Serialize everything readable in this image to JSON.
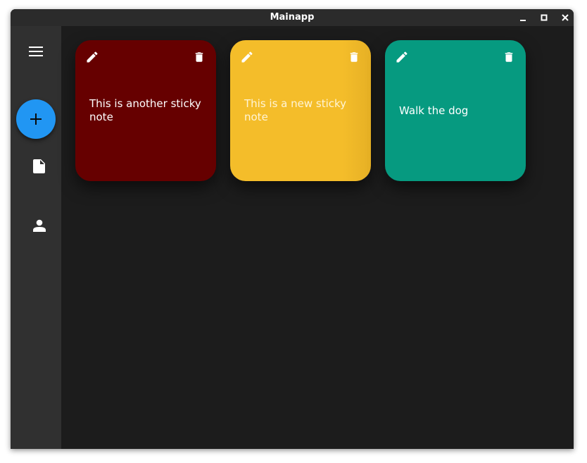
{
  "window": {
    "title": "Mainapp"
  },
  "window_controls": [
    {
      "name": "minimize",
      "icon": "minimize-icon"
    },
    {
      "name": "maximize",
      "icon": "maximize-icon"
    },
    {
      "name": "close",
      "icon": "close-icon"
    }
  ],
  "rail": {
    "items": [
      {
        "name": "menu",
        "icon": "menu-icon"
      },
      {
        "name": "add",
        "icon": "plus-icon",
        "color": "#2196f3"
      },
      {
        "name": "notes",
        "icon": "document-icon"
      },
      {
        "name": "account",
        "icon": "person-icon"
      }
    ]
  },
  "notes": [
    {
      "text": "This is another sticky note",
      "color": "#660000",
      "edit_icon": "pencil-icon",
      "delete_icon": "trash-icon"
    },
    {
      "text": "This is a new sticky note",
      "color": "#f4bd2a",
      "edit_icon": "pencil-icon",
      "delete_icon": "trash-icon"
    },
    {
      "text": "Walk the dog",
      "color": "#069a80",
      "edit_icon": "pencil-icon",
      "delete_icon": "trash-icon"
    }
  ]
}
